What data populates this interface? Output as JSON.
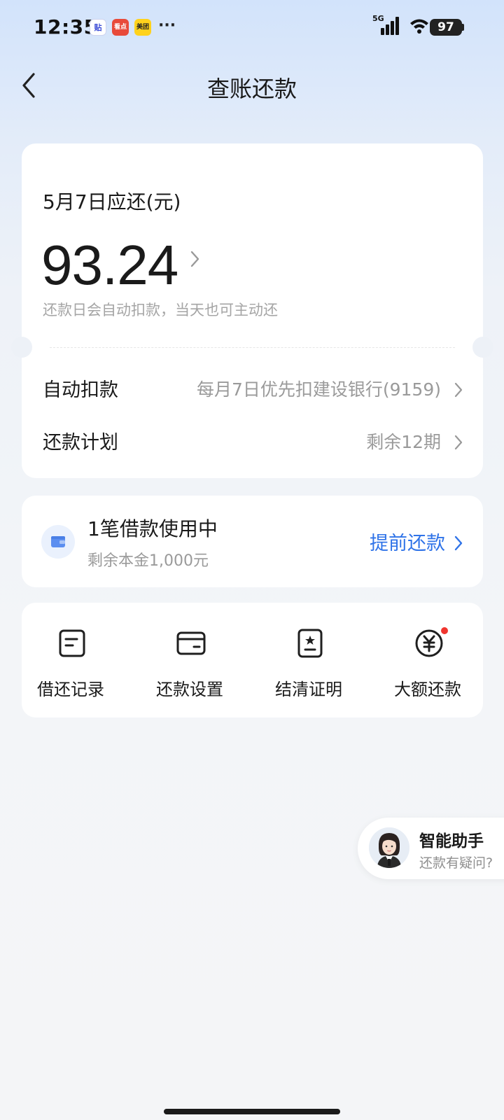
{
  "status_bar": {
    "time": "12:35",
    "app_badges": [
      "贴",
      "看点",
      "美团"
    ],
    "more": "···",
    "network": "5G",
    "battery": "97"
  },
  "header": {
    "title": "查账还款"
  },
  "bill": {
    "due_label": "5月7日应还(元)",
    "amount": "93.24",
    "hint": "还款日会自动扣款，当天也可主动还",
    "auto_debit_label": "自动扣款",
    "auto_debit_value": "每月7日优先扣建设银行(9159)",
    "plan_label": "还款计划",
    "plan_value": "剩余12期"
  },
  "loan": {
    "title": "1笔借款使用中",
    "remaining": "剩余本金1,000元",
    "prepay_label": "提前还款"
  },
  "tools": {
    "items": [
      {
        "label": "借还记录",
        "icon": "record-icon"
      },
      {
        "label": "还款设置",
        "icon": "wallet-card-icon"
      },
      {
        "label": "结清证明",
        "icon": "certificate-icon"
      },
      {
        "label": "大额还款",
        "icon": "yuan-icon"
      }
    ]
  },
  "assistant": {
    "title": "智能助手",
    "subtitle": "还款有疑问?"
  },
  "colors": {
    "accent": "#2f73e8",
    "badge_red": "#f0352e"
  }
}
